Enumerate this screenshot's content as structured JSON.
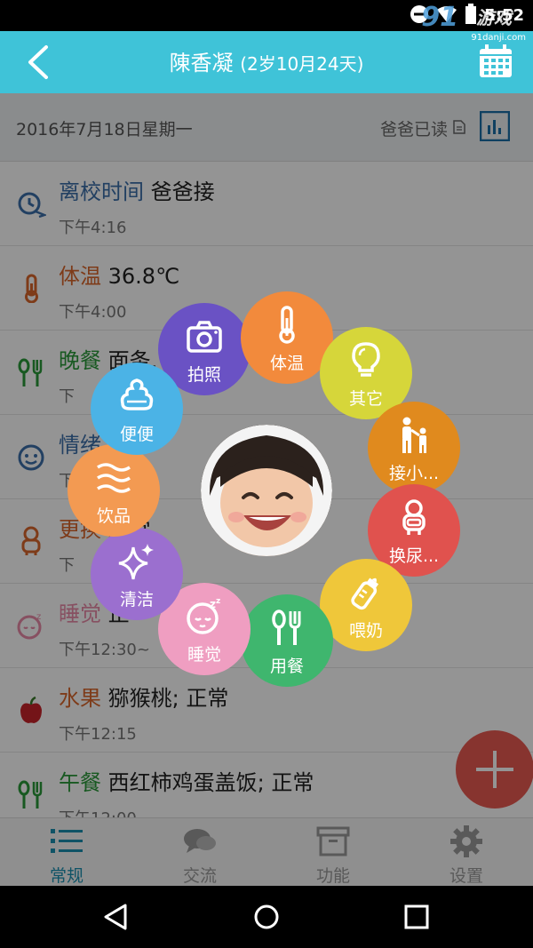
{
  "status": {
    "time": "5:52",
    "brand_num": "91",
    "brand_name": "游戏",
    "brand_url": "91danji.com"
  },
  "header": {
    "child_name": "陳香凝",
    "age": "(2岁10月24天)",
    "back_icon": "back-arrow-icon",
    "calendar_icon": "calendar-icon"
  },
  "date_row": {
    "date": "2016年7月18日星期一",
    "read_status": "爸爸已读"
  },
  "records": [
    {
      "category": "离校时间",
      "value": " 爸爸接",
      "time": "下午4:16",
      "color": "#3b6eaa",
      "icon": "clock-arrow-icon"
    },
    {
      "category": "体温",
      "value": " 36.8℃",
      "time": "下午4:00",
      "color": "#d9672c",
      "icon": "thermometer-icon"
    },
    {
      "category": "晚餐",
      "value": " 面条,",
      "time": "下",
      "color": "#2a9a3a",
      "icon": "spoon-fork-icon"
    },
    {
      "category": "情绪",
      "value": "",
      "time": "下",
      "color": "#3b6eaa",
      "icon": "mood-icon"
    },
    {
      "category": "更换",
      "value": " 正常",
      "time": "下",
      "color": "#d9672c",
      "icon": "baby-icon"
    },
    {
      "category": "睡觉",
      "value": " 正",
      "time": "下午12:30~",
      "color": "#e98aa8",
      "icon": "sleep-icon"
    },
    {
      "category": "水果",
      "value": " 猕猴桃; 正常",
      "time": "下午12:15",
      "color": "#d9672c",
      "icon": "apple-icon"
    },
    {
      "category": "午餐",
      "value": " 西红柿鸡蛋盖饭; 正常",
      "time": "下午12:00",
      "color": "#2a9a3a",
      "icon": "spoon-fork-icon"
    }
  ],
  "menu": [
    {
      "label": "拍照",
      "color": "#6a52c4",
      "icon": "camera-icon"
    },
    {
      "label": "体温",
      "color": "#f28a3c",
      "icon": "thermometer-icon"
    },
    {
      "label": "其它",
      "color": "#d6d63a",
      "icon": "lightbulb-icon"
    },
    {
      "label": "接小...",
      "color": "#e08a1e",
      "icon": "parent-child-icon"
    },
    {
      "label": "换尿...",
      "color": "#e0524e",
      "icon": "baby-icon"
    },
    {
      "label": "喂奶",
      "color": "#efc73a",
      "icon": "bottle-icon"
    },
    {
      "label": "用餐",
      "color": "#3fb66e",
      "icon": "spoon-fork-icon"
    },
    {
      "label": "睡觉",
      "color": "#ef9ec1",
      "icon": "sleep-face-icon"
    },
    {
      "label": "清洁",
      "color": "#9b6fcf",
      "icon": "sparkle-icon"
    },
    {
      "label": "饮品",
      "color": "#f39a52",
      "icon": "waves-icon"
    },
    {
      "label": "便便",
      "color": "#4bb3e6",
      "icon": "poop-icon"
    }
  ],
  "tabs": [
    {
      "label": "常规",
      "icon": "list-icon"
    },
    {
      "label": "交流",
      "icon": "chat-icon"
    },
    {
      "label": "功能",
      "icon": "box-icon"
    },
    {
      "label": "设置",
      "icon": "gear-icon"
    }
  ]
}
